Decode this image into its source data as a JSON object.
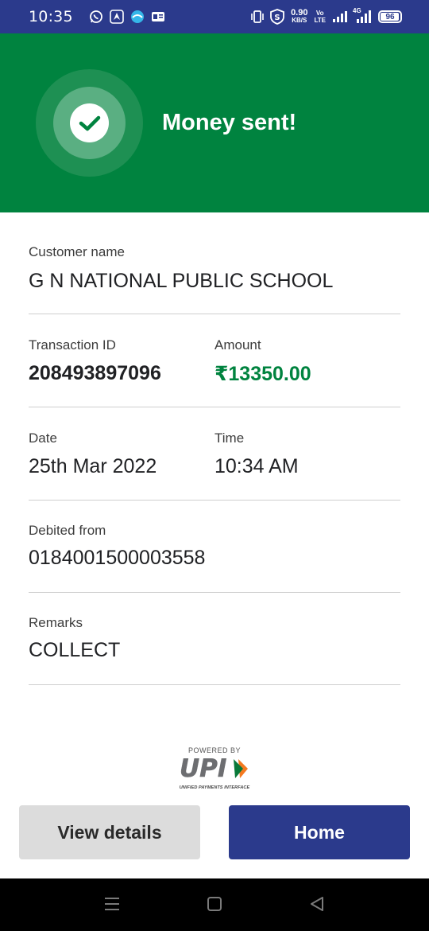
{
  "status_bar": {
    "time": "10:35",
    "net_speed_value": "0.90",
    "net_speed_unit": "KB/S",
    "volte_top": "Vo",
    "volte_bottom": "LTE",
    "network_type": "4G",
    "battery": "96",
    "battery_percent": 96,
    "left_icons": [
      "whatsapp-icon",
      "navigation-app-icon",
      "bubble-app-icon",
      "news-app-icon"
    ],
    "right_icons": [
      "vibrate-icon",
      "vpn-shield-icon",
      "signal-icon",
      "signal-4g-icon",
      "battery-icon"
    ]
  },
  "header": {
    "title": "Money sent!",
    "icon": "check-circle-icon",
    "background_color": "#00833f"
  },
  "details": {
    "customer_name_label": "Customer name",
    "customer_name_value": "G N NATIONAL PUBLIC SCHOOL",
    "transaction_id_label": "Transaction ID",
    "transaction_id_value": "208493897096",
    "amount_label": "Amount",
    "amount_value": "₹13350.00",
    "date_label": "Date",
    "date_value": "25th Mar 2022",
    "time_label": "Time",
    "time_value": "10:34 AM",
    "debited_from_label": "Debited from",
    "debited_from_value": "0184001500003558",
    "remarks_label": "Remarks",
    "remarks_value": "COLLECT"
  },
  "upi": {
    "powered_by": "POWERED BY",
    "logo_text": "UPI",
    "tagline": "UNIFIED PAYMENTS INTERFACE"
  },
  "actions": {
    "view_details_label": "View details",
    "home_label": "Home",
    "primary_color": "#2b3a8c"
  },
  "nav_bar": {
    "items": [
      "menu-icon",
      "home-square-icon",
      "back-triangle-icon"
    ]
  }
}
